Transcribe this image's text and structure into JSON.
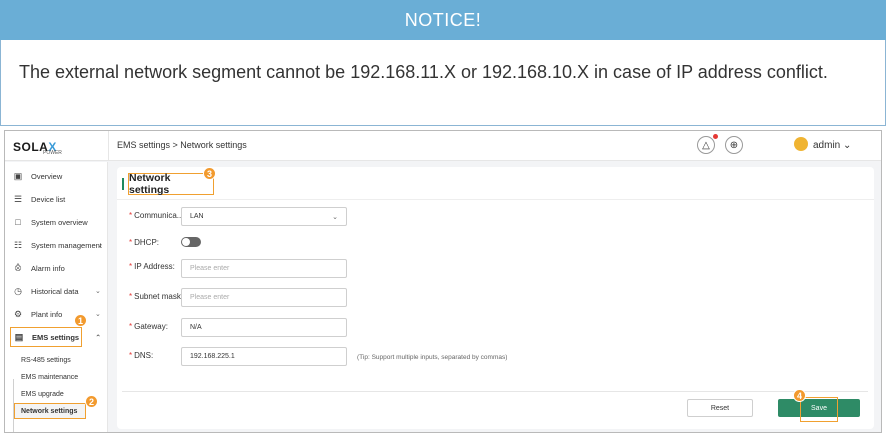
{
  "notice": {
    "title": "NOTICE!",
    "text": "The external network segment cannot be 192.168.11.X or 192.168.10.X in case of IP address conflict."
  },
  "logo": {
    "main": "SOLA",
    "x": "X",
    "sub": "POWER"
  },
  "breadcrumb": "EMS settings > Network settings",
  "header": {
    "bell_icon": "bell-icon",
    "globe_icon": "globe-icon",
    "user": "admin"
  },
  "sidebar": {
    "items": [
      {
        "label": "Overview",
        "icon": "overview-icon"
      },
      {
        "label": "Device list",
        "icon": "device-list-icon"
      },
      {
        "label": "System overview",
        "icon": "system-overview-icon"
      },
      {
        "label": "System management",
        "icon": "system-management-icon"
      },
      {
        "label": "Alarm info",
        "icon": "alarm-icon"
      },
      {
        "label": "Historical data",
        "icon": "history-icon"
      },
      {
        "label": "Plant info",
        "icon": "plant-icon"
      },
      {
        "label": "EMS settings",
        "icon": "ems-icon"
      }
    ],
    "sub_items": [
      "RS-485 settings",
      "EMS maintenance",
      "EMS upgrade",
      "Network settings"
    ]
  },
  "card": {
    "title": "Network settings",
    "fields": {
      "communication": {
        "label": "Communica... :",
        "value": "LAN"
      },
      "dhcp": {
        "label": "DHCP:",
        "on": false
      },
      "ip": {
        "label": "IP Address:",
        "placeholder": "Please enter"
      },
      "subnet": {
        "label": "Subnet mask:",
        "placeholder": "Please enter"
      },
      "gateway": {
        "label": "Gateway:",
        "value": "N/A"
      },
      "dns": {
        "label": "DNS:",
        "value": "192.168.225.1",
        "tip": "(Tip: Support multiple inputs, separated by commas)"
      }
    },
    "reset_label": "Reset",
    "save_label": "Save"
  },
  "badges": [
    "1",
    "2",
    "3",
    "4"
  ],
  "colors": {
    "notice": "#6aaed6",
    "accent": "#2e8b66",
    "highlight": "#f0a030",
    "badge": "#f29a2e"
  }
}
